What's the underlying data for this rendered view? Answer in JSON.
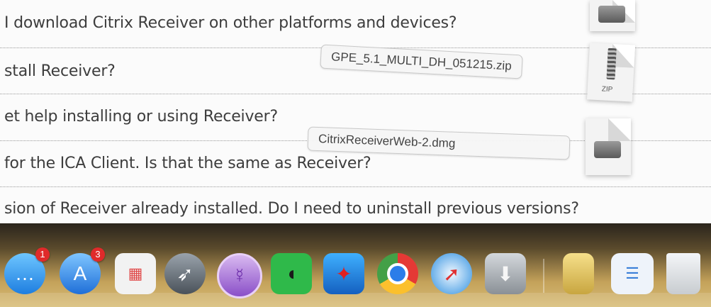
{
  "faq": {
    "items": [
      "I download Citrix Receiver on other platforms and devices?",
      "stall Receiver?",
      "et help installing or using Receiver?",
      " for the ICA Client. Is that the same as Receiver?",
      "sion of Receiver already installed. Do I need to uninstall previous versions?"
    ]
  },
  "downloads": {
    "file1": "GPE_5.1_MULTI_DH_051215.zip",
    "file2": "CitrixReceiverWeb-2.dmg",
    "zip_label": "ZIP"
  },
  "dock": {
    "messages_badge": "1",
    "appstore_badge": "3",
    "icons": [
      "messages-icon",
      "app-store-icon",
      "launchpad-icon",
      "rocket-icon",
      "tor-icon",
      "evernote-icon",
      "citrix-receiver-icon",
      "chrome-icon",
      "safari-icon",
      "downloads-icon",
      "documents-stack-icon",
      "keynote-icon",
      "trash-icon"
    ]
  }
}
